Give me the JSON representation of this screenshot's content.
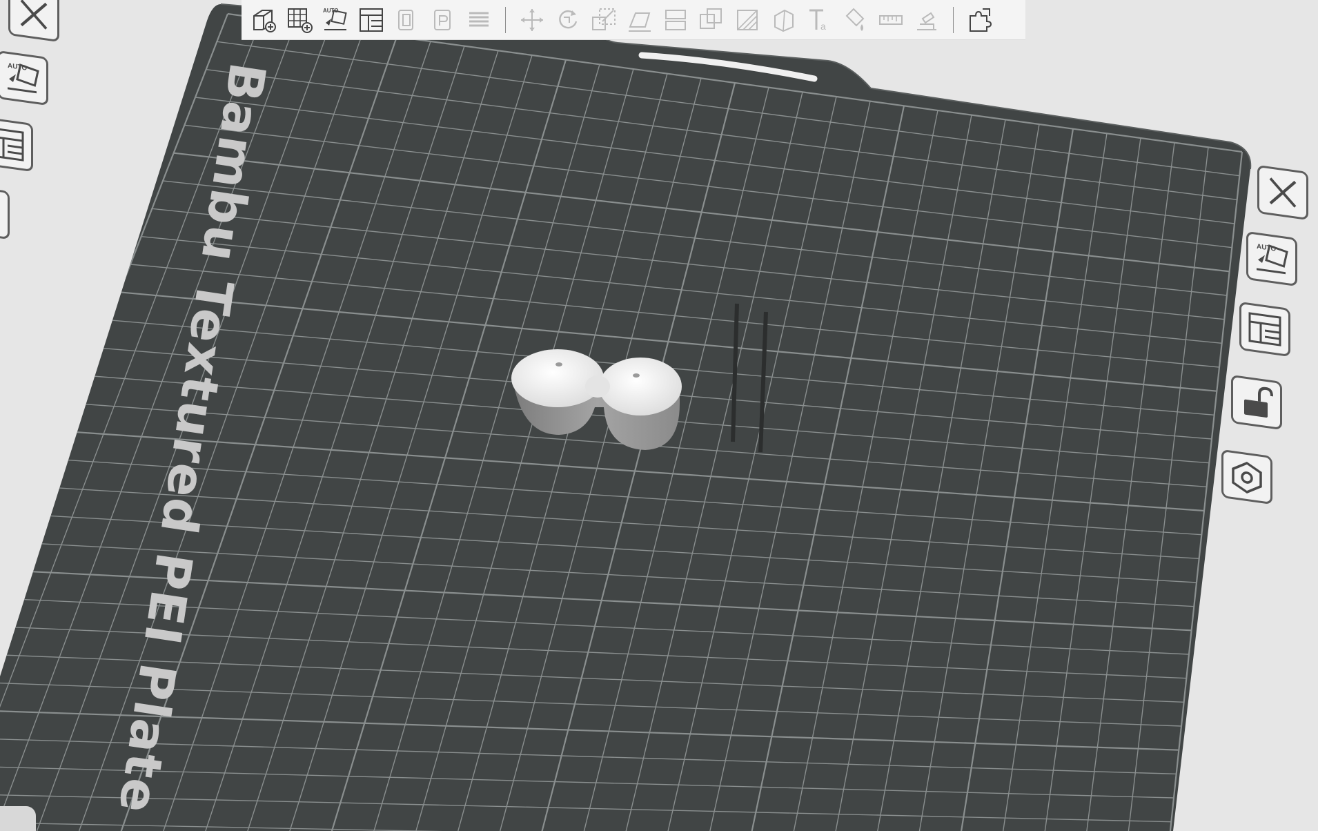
{
  "plate": {
    "label": "Bambu Textured PEI Plate"
  },
  "colors": {
    "plate": "#414545",
    "grid": "#8a8f8f",
    "background": "#e6e6e6",
    "model": "#f2f2f2"
  },
  "toolbar": {
    "items": [
      {
        "icon": "add-cube-icon",
        "enabled": true
      },
      {
        "icon": "add-plate-icon",
        "enabled": true
      },
      {
        "icon": "auto-orient-icon",
        "enabled": true
      },
      {
        "icon": "arrange-icon",
        "enabled": true
      },
      {
        "icon": "copy-icon",
        "enabled": false
      },
      {
        "icon": "paste-icon",
        "enabled": false
      },
      {
        "icon": "layers-icon",
        "enabled": false
      },
      {
        "icon": "separator",
        "enabled": true
      },
      {
        "icon": "move-icon",
        "enabled": false
      },
      {
        "icon": "rotate-icon",
        "enabled": false
      },
      {
        "icon": "scale-icon",
        "enabled": false
      },
      {
        "icon": "lay-on-face-icon",
        "enabled": false
      },
      {
        "icon": "cut-icon",
        "enabled": false
      },
      {
        "icon": "boolean-icon",
        "enabled": false
      },
      {
        "icon": "support-paint-icon",
        "enabled": false
      },
      {
        "icon": "seam-paint-icon",
        "enabled": false
      },
      {
        "icon": "text-icon",
        "enabled": false
      },
      {
        "icon": "color-paint-icon",
        "enabled": false
      },
      {
        "icon": "measure-icon",
        "enabled": false
      },
      {
        "icon": "assembly-icon",
        "enabled": false
      },
      {
        "icon": "separator",
        "enabled": true
      },
      {
        "icon": "explode-icon",
        "enabled": true
      }
    ],
    "auto_label": "AUTO"
  },
  "plate_controls_right": [
    {
      "icon": "close-icon"
    },
    {
      "icon": "auto-arrange-icon",
      "label": "AUTO"
    },
    {
      "icon": "arrange-layout-icon"
    },
    {
      "icon": "unlock-icon"
    },
    {
      "icon": "settings-hex-icon"
    }
  ],
  "plate_controls_left": [
    {
      "icon": "close-icon"
    },
    {
      "icon": "auto-arrange-icon",
      "label": "AUTO"
    },
    {
      "icon": "arrange-layout-icon"
    }
  ]
}
